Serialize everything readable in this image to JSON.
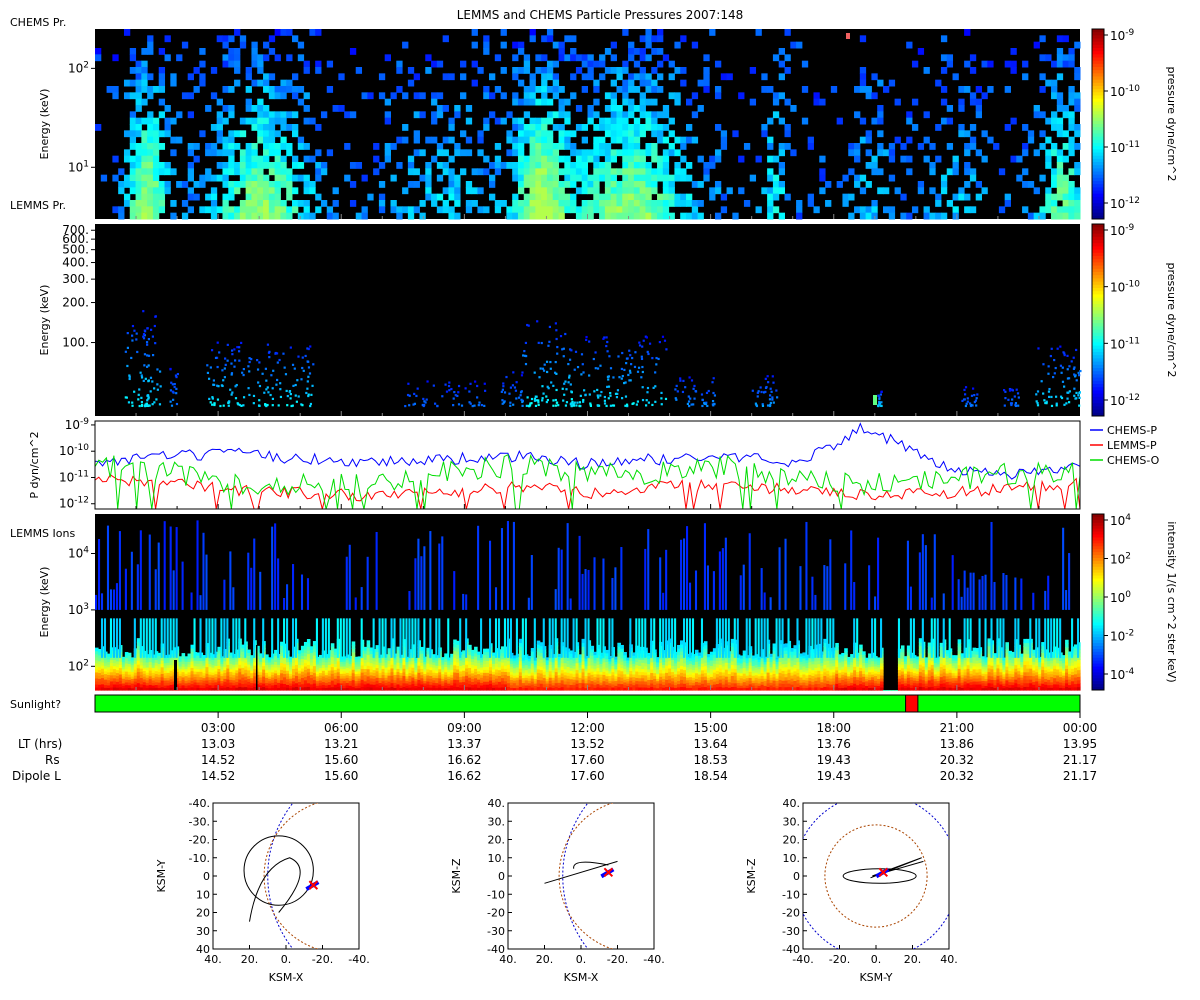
{
  "title": "LEMMS and CHEMS Particle Pressures  2007:148",
  "panels": {
    "chems": {
      "label": "CHEMS Pr.",
      "ylabel": "Energy (keV)",
      "yticks": [
        {
          "v": 100,
          "t": "10",
          "e": "2"
        },
        {
          "v": 10,
          "t": "10",
          "e": "1"
        }
      ],
      "ylim": [
        3,
        250
      ],
      "colorbar": {
        "label": "pressure dyne/cm^2",
        "ticks": [
          {
            "t": "10",
            "e": "-9"
          },
          {
            "t": "10",
            "e": "-10"
          },
          {
            "t": "10",
            "e": "-11"
          },
          {
            "t": "10",
            "e": "-12"
          }
        ]
      }
    },
    "lemms": {
      "label": "LEMMS Pr.",
      "ylabel": "Energy (keV)",
      "yticks": [
        "700.",
        "600.",
        "500.",
        "400.",
        "300.",
        "200.",
        "100."
      ],
      "ytick_values": [
        700,
        600,
        500,
        400,
        300,
        200,
        100
      ],
      "ylim": [
        28,
        780
      ],
      "colorbar": {
        "label": "pressure dyne/cm^2",
        "ticks": [
          {
            "t": "10",
            "e": "-9"
          },
          {
            "t": "10",
            "e": "-10"
          },
          {
            "t": "10",
            "e": "-11"
          },
          {
            "t": "10",
            "e": "-12"
          }
        ]
      }
    },
    "pressure": {
      "ylabel": "P dyn/cm^2",
      "yticks": [
        {
          "v": -9,
          "t": "10",
          "e": "-9"
        },
        {
          "v": -10,
          "t": "10",
          "e": "-10"
        },
        {
          "v": -11,
          "t": "10",
          "e": "-11"
        },
        {
          "v": -12,
          "t": "10",
          "e": "-12"
        }
      ],
      "legend": [
        {
          "name": "CHEMS-P",
          "color": "#0000ff"
        },
        {
          "name": "LEMMS-P",
          "color": "#ff0000"
        },
        {
          "name": "CHEMS-O",
          "color": "#00dd00"
        }
      ]
    },
    "ions": {
      "label": "LEMMS Ions",
      "ylabel": "Energy (keV)",
      "yticks": [
        {
          "v": 4,
          "t": "10",
          "e": "4"
        },
        {
          "v": 3,
          "t": "10",
          "e": "3"
        },
        {
          "v": 2,
          "t": "10",
          "e": "2"
        }
      ],
      "colorbar": {
        "label": "intensity 1/(s cm^2 ster keV)",
        "ticks": [
          {
            "t": "10",
            "e": "4"
          },
          {
            "t": "10",
            "e": "2"
          },
          {
            "t": "10",
            "e": "0"
          },
          {
            "t": "10",
            "e": "-2"
          },
          {
            "t": "10",
            "e": "-4"
          }
        ]
      }
    },
    "sunlight": {
      "label": "Sunlight?",
      "color_on": "#00ff00",
      "color_off": "#ff0000"
    }
  },
  "time_axis": {
    "ticks": [
      "03:00",
      "06:00",
      "09:00",
      "12:00",
      "15:00",
      "18:00",
      "21:00",
      "00:00"
    ],
    "rows": [
      {
        "label": "LT (hrs)",
        "values": [
          "13.03",
          "13.21",
          "13.37",
          "13.52",
          "13.64",
          "13.76",
          "13.86",
          "13.95"
        ]
      },
      {
        "label": "Rs",
        "values": [
          "14.52",
          "15.60",
          "16.62",
          "17.60",
          "18.53",
          "19.43",
          "20.32",
          "21.17"
        ]
      },
      {
        "label": "Dipole L",
        "values": [
          "14.52",
          "15.60",
          "16.62",
          "17.60",
          "18.54",
          "19.43",
          "20.32",
          "21.17"
        ]
      }
    ]
  },
  "orbit_plots": [
    {
      "xlabel": "KSM-X",
      "ylabel": "KSM-Y",
      "xticks": [
        "40.",
        "20.",
        "0.",
        "-20.",
        "-40."
      ],
      "yticks": [
        "-40.",
        "-30.",
        "-20.",
        "-10.",
        "0",
        "10",
        "20",
        "30",
        "40"
      ]
    },
    {
      "xlabel": "KSM-X",
      "ylabel": "KSM-Z",
      "xticks": [
        "40.",
        "20.",
        "0.",
        "-20.",
        "-40."
      ],
      "yticks": [
        "40.",
        "30.",
        "20.",
        "10.",
        "0",
        "-10",
        "-20",
        "-30",
        "-40"
      ]
    },
    {
      "xlabel": "KSM-Y",
      "ylabel": "KSM-Z",
      "xticks": [
        "-40.",
        "-20.",
        "0.",
        "20.",
        "40."
      ],
      "yticks": [
        "40.",
        "30.",
        "20.",
        "10.",
        "0",
        "-10",
        "-20",
        "-30",
        "-40"
      ]
    }
  ],
  "chart_data": {
    "type": "heatmap",
    "x_range_hours": [
      0,
      24
    ],
    "sunlight_shadow_hours": [
      19.75,
      20.05
    ],
    "pressure_series": [
      {
        "name": "CHEMS-P",
        "values_log10": [
          -10.4,
          -10.2,
          -10.1,
          -10.3,
          -10.4,
          -10.3,
          -10.2,
          -10.5,
          -10.3,
          -10.2,
          -10.4,
          -9.1,
          -10.6,
          -10.9,
          -10.5
        ]
      },
      {
        "name": "LEMMS-P",
        "values_log10": [
          -11.0,
          -11.2,
          -11.5,
          -11.6,
          -11.7,
          -11.6,
          -11.3,
          -11.6,
          -11.3,
          -11.3,
          -11.5,
          -11.7,
          -11.6,
          -11.4,
          -11.2
        ]
      },
      {
        "name": "CHEMS-O",
        "values_log10": [
          -10.5,
          -10.8,
          -11.2,
          -11.3,
          -11.2,
          -10.8,
          -10.5,
          -10.9,
          -10.8,
          -10.6,
          -10.9,
          -11.3,
          -11.1,
          -10.9,
          -10.8
        ]
      }
    ]
  }
}
